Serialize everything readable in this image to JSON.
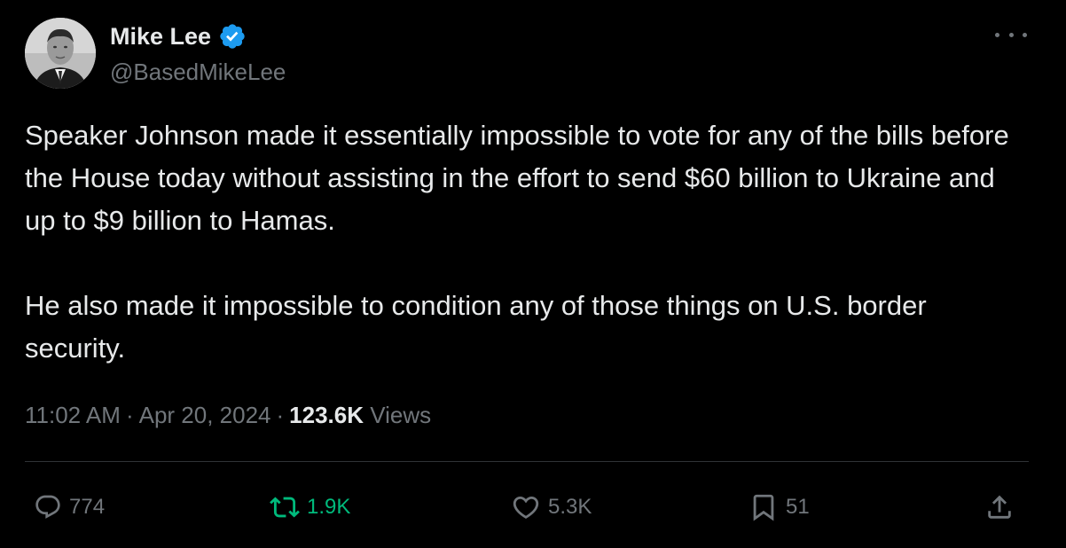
{
  "author": {
    "display_name": "Mike Lee",
    "handle": "@BasedMikeLee",
    "verified": true,
    "verified_color": "#1d9bf0"
  },
  "tweet": {
    "paragraphs": [
      "Speaker Johnson made it essentially impossible to vote for any of the bills before the House today without assisting in the effort to send $60 billion to Ukraine and up to $9 billion to Hamas.",
      "He also made it impossible to condition any of those things on U.S. border security."
    ]
  },
  "meta": {
    "time": "11:02 AM",
    "separator": "·",
    "date": "Apr 20, 2024",
    "views_count": "123.6K",
    "views_label": "Views"
  },
  "actions": {
    "replies": "774",
    "reposts": "1.9K",
    "likes": "5.3K",
    "bookmarks": "51"
  },
  "icons": {
    "more": "more-horizontal-icon",
    "reply": "reply-bubble-icon",
    "repost": "repost-icon",
    "like": "heart-icon",
    "bookmark": "bookmark-icon",
    "share": "share-upload-icon"
  },
  "colors": {
    "background": "#000000",
    "text_primary": "#e7e9ea",
    "text_secondary": "#71767b",
    "repost_active": "#00ba7c",
    "divider": "#2f3336"
  }
}
